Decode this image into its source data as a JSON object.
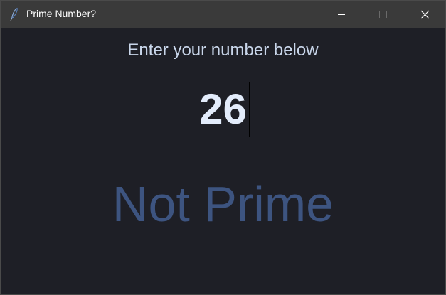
{
  "window": {
    "title": "Prime Number?",
    "app_icon": "feather-icon",
    "controls": [
      "minimize-icon",
      "maximize-icon",
      "close-icon"
    ]
  },
  "main": {
    "prompt": "Enter your number below",
    "number_input": {
      "value": "26"
    },
    "result": "Not Prime"
  },
  "colors": {
    "background": "#1e1f26",
    "titlebar": "#3a3a3a",
    "prompt_text": "#c9d6ea",
    "input_text": "#e3ecfb",
    "result_text": "#3d5480"
  }
}
